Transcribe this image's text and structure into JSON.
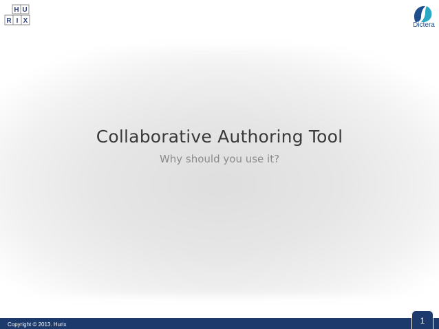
{
  "slide": {
    "title": "Collaborative Authoring Tool",
    "subtitle": "Why should you use it?"
  },
  "logos": {
    "left": {
      "name": "hurix-logo",
      "letters": [
        "H",
        "U",
        "R",
        "I",
        "X"
      ]
    },
    "right": {
      "name": "dictera-logo",
      "text": "Dictera"
    }
  },
  "footer": {
    "copyright": "Copyright © 2013. Hurix",
    "page_number": "1"
  },
  "colors": {
    "footer_bar": "#1c3a6b",
    "title": "#3a3a3a",
    "subtitle": "#8a8a8a",
    "dictera_teal": "#29a9c4",
    "dictera_blue": "#1e4f8c"
  }
}
